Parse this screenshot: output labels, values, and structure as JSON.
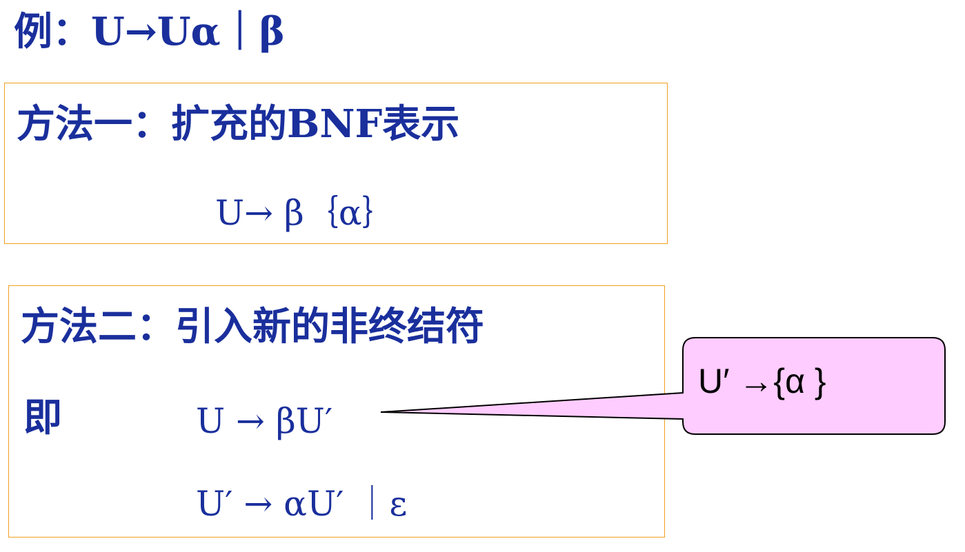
{
  "example": {
    "line": "例：U→Uα｜β"
  },
  "method_one": {
    "title": "方法一：扩充的BNF表示",
    "formula": "U→ β｛α｝"
  },
  "method_two": {
    "title": "方法二：引入新的非终结符",
    "prefix": "即",
    "formula_1": "U → βU′",
    "formula_2": "U′ → αU′ ｜ε"
  },
  "callout": {
    "text": "U′ →{α }",
    "fill_color": "#ffccff",
    "stroke_color": "#000000"
  },
  "colors": {
    "text": "#1a2f9c",
    "box_border": "#f0a020"
  }
}
